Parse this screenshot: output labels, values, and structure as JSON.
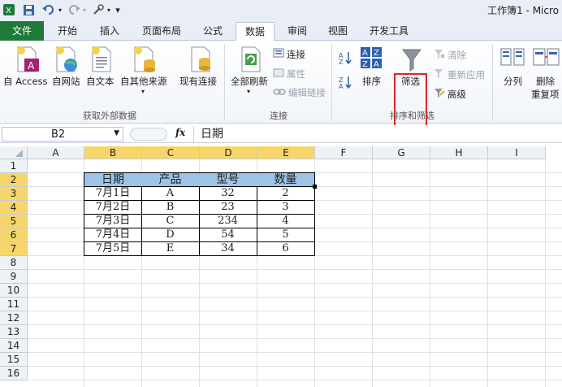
{
  "window": {
    "title": "工作簿1 - Micro"
  },
  "tabs": [
    "文件",
    "开始",
    "插入",
    "页面布局",
    "公式",
    "数据",
    "审阅",
    "视图",
    "开发工具"
  ],
  "ribbon": {
    "external": {
      "buttons": [
        "自 Access",
        "自网站",
        "自文本",
        "自其他来源",
        "现有连接"
      ],
      "group_label": "获取外部数据"
    },
    "connections": {
      "refresh_all": "全部刷新",
      "connections": "连接",
      "properties": "属性",
      "edit_links": "编辑链接",
      "group_label": "连接"
    },
    "sort_filter": {
      "sort": "排序",
      "filter": "筛选",
      "clear": "清除",
      "reapply": "重新应用",
      "advanced": "高级",
      "group_label": "排序和筛选"
    },
    "data_tools": {
      "split": "分列",
      "remove_dup_1": "删除",
      "remove_dup_2": "重复项"
    }
  },
  "formula_bar": {
    "name_box": "B2",
    "fx": "fx",
    "content": "日期"
  },
  "sheet": {
    "columns": [
      "A",
      "B",
      "C",
      "D",
      "E",
      "F",
      "G",
      "H",
      "I"
    ],
    "rows": [
      "1",
      "2",
      "3",
      "4",
      "5",
      "6",
      "7",
      "8",
      "9",
      "10",
      "11",
      "12",
      "13",
      "14",
      "15",
      "16"
    ],
    "table": {
      "headers": [
        "日期",
        "产品",
        "型号",
        "数量"
      ],
      "rows": [
        [
          "7月1日",
          "A",
          "32",
          "2"
        ],
        [
          "7月2日",
          "B",
          "23",
          "3"
        ],
        [
          "7月3日",
          "C",
          "234",
          "4"
        ],
        [
          "7月4日",
          "D",
          "54",
          "5"
        ],
        [
          "7月5日",
          "E",
          "34",
          "6"
        ]
      ]
    }
  },
  "colors": {
    "file_tab": "#1f7a3a",
    "selected_header": "#f6d66b",
    "table_header_fill": "#9dc3e6",
    "highlight": "#e02424"
  }
}
